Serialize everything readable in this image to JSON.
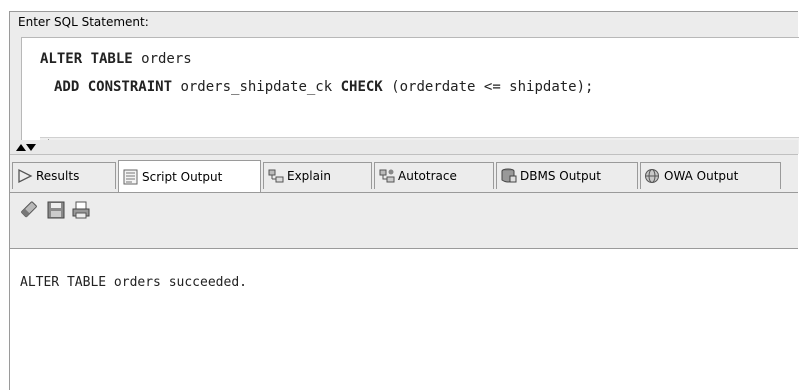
{
  "editor": {
    "label": "Enter SQL Statement:",
    "line1_kw": "ALTER TABLE",
    "line1_rest": " orders",
    "line2_kw1": "ADD CONSTRAINT",
    "line2_mid": " orders_shipdate_ck ",
    "line2_kw2": "CHECK",
    "line2_rest": " (orderdate <= shipdate);"
  },
  "tabs": [
    {
      "label": "Results",
      "icon": "play-triangle-icon"
    },
    {
      "label": "Script Output",
      "icon": "script-output-icon",
      "active": true
    },
    {
      "label": "Explain",
      "icon": "explain-plan-icon"
    },
    {
      "label": "Autotrace",
      "icon": "autotrace-icon"
    },
    {
      "label": "DBMS Output",
      "icon": "dbms-output-icon"
    },
    {
      "label": "OWA Output",
      "icon": "owa-globe-icon"
    }
  ],
  "toolbar": {
    "clear_icon": "eraser-icon",
    "save_icon": "save-disk-icon",
    "print_icon": "printer-icon"
  },
  "output": {
    "text": "ALTER TABLE orders succeeded."
  }
}
